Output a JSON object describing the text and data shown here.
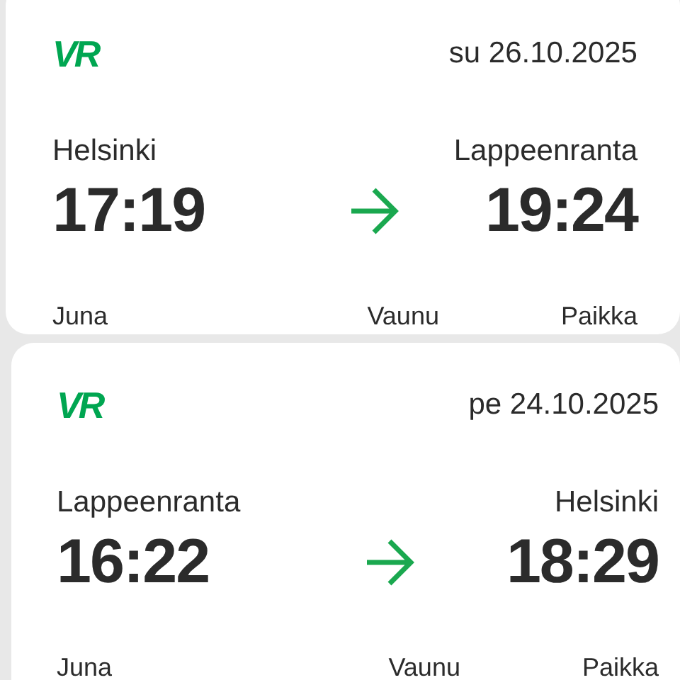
{
  "tickets": [
    {
      "logo": "VR",
      "date": "su 26.10.2025",
      "from": {
        "city": "Helsinki",
        "time": "17:19"
      },
      "to": {
        "city": "Lappeenranta",
        "time": "19:24"
      },
      "labels": [
        "Juna",
        "Vaunu",
        "Paikka"
      ]
    },
    {
      "logo": "VR",
      "date": "pe 24.10.2025",
      "from": {
        "city": "Lappeenranta",
        "time": "16:22"
      },
      "to": {
        "city": "Helsinki",
        "time": "18:29"
      },
      "labels": [
        "Juna",
        "Vaunu",
        "Paikka"
      ]
    }
  ]
}
